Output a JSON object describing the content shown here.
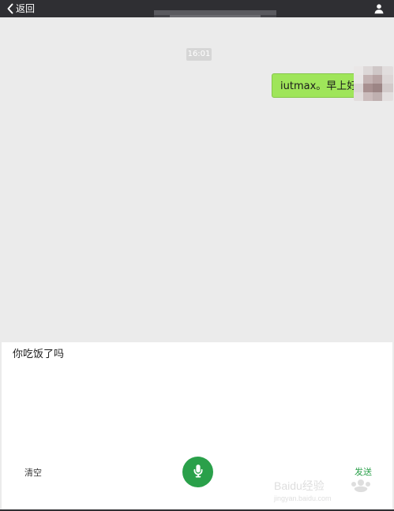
{
  "topbar": {
    "back_label": "返回",
    "icons": {
      "back": "chevron-left-icon",
      "profile": "person-icon"
    }
  },
  "chat": {
    "timestamp": "16:01",
    "messages": [
      {
        "text": "iutmax。早上好",
        "side": "right",
        "bubble_color": "#9fe55a"
      }
    ]
  },
  "input_panel": {
    "text": "你吃饭了吗",
    "clear_label": "清空",
    "send_label": "发送",
    "icons": {
      "mic": "microphone-icon"
    },
    "colors": {
      "accent": "#2aa04a"
    }
  },
  "watermark": {
    "text": "Baidu经验",
    "subtext": "jingyan.baidu.com"
  }
}
